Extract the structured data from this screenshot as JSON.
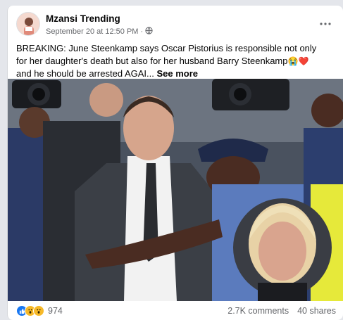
{
  "post": {
    "page_name": "Mzansi Trending",
    "timestamp": "September 20 at 12:50 PM",
    "separator": "·",
    "privacy_icon": "globe-icon",
    "text": "BREAKING: June Steenkamp says Oscar Pistorius is responsible not only for her daughter's death but also for her husband Barry Steenkamp",
    "text_emojis": "😭❤️",
    "text_continued": " and he should be arrested AGAI...",
    "see_more": "See more",
    "more_options_icon": "ellipsis-icon"
  },
  "footer": {
    "reaction_icons": [
      "like-icon",
      "wow-icon",
      "wow-icon"
    ],
    "reaction_count": "974",
    "comments": "2.7K comments",
    "shares": "40 shares"
  },
  "colors": {
    "facebook_blue": "#1877f2",
    "secondary_text": "#65676b",
    "background": "#e4e6eb"
  }
}
